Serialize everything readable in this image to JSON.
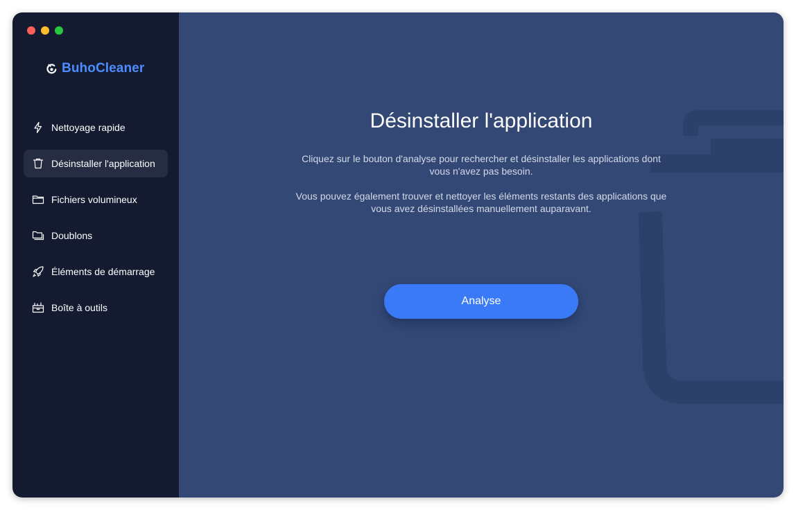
{
  "app": {
    "name": "BuhoCleaner",
    "brand_color": "#4c8dff",
    "logo_icon": "owl-logo-icon"
  },
  "window_controls": [
    "close",
    "minimize",
    "maximize"
  ],
  "sidebar": {
    "items": [
      {
        "label": "Nettoyage rapide",
        "icon": "lightning-icon",
        "active": false
      },
      {
        "label": "Désinstaller l'application",
        "icon": "trash-icon",
        "active": true
      },
      {
        "label": "Fichiers volumineux",
        "icon": "folder-icon",
        "active": false
      },
      {
        "label": "Doublons",
        "icon": "folders-icon",
        "active": false
      },
      {
        "label": "Éléments de démarrage",
        "icon": "rocket-icon",
        "active": false
      },
      {
        "label": "Boîte à outils",
        "icon": "toolbox-icon",
        "active": false
      }
    ]
  },
  "main": {
    "title": "Désinstaller l'application",
    "paragraph1": "Cliquez sur le bouton d'analyse pour rechercher et désinstaller les applications dont vous n'avez pas besoin.",
    "paragraph2": "Vous pouvez également trouver et nettoyer les éléments restants des applications que vous avez désinstallées manuellement auparavant.",
    "button_label": "Analyse",
    "background_icon": "trash-icon",
    "accent_color": "#3b7af6"
  }
}
